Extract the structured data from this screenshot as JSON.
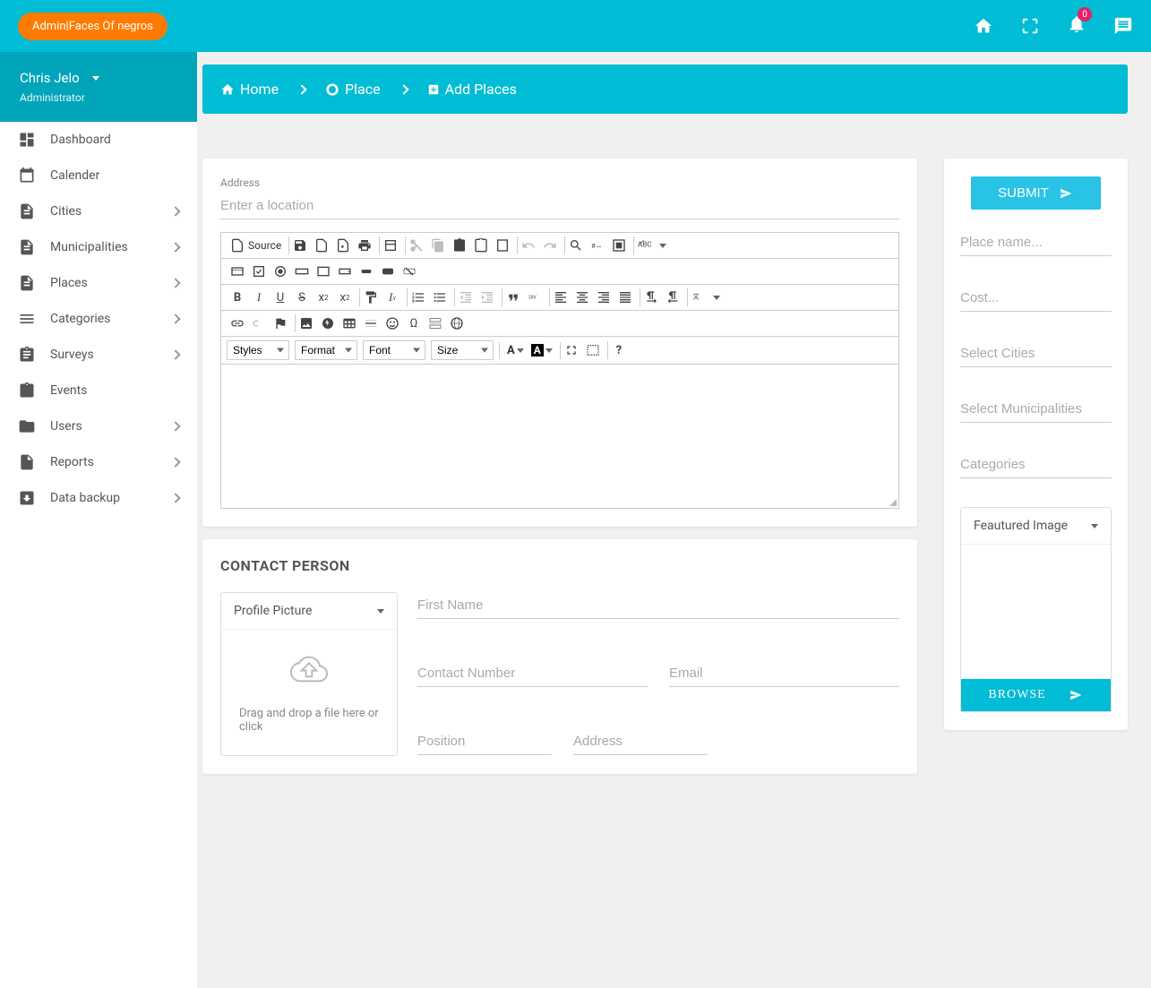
{
  "topbar": {
    "brand": "Admin|Faces Of negros",
    "badge": "0"
  },
  "profile": {
    "name": "Chris Jelo",
    "role": "Administrator"
  },
  "nav": [
    {
      "label": "Dashboard",
      "expandable": false
    },
    {
      "label": "Calender",
      "expandable": false
    },
    {
      "label": "Cities",
      "expandable": true
    },
    {
      "label": "Municipalities",
      "expandable": true
    },
    {
      "label": "Places",
      "expandable": true
    },
    {
      "label": "Categories",
      "expandable": true
    },
    {
      "label": "Surveys",
      "expandable": true
    },
    {
      "label": "Events",
      "expandable": false
    },
    {
      "label": "Users",
      "expandable": true
    },
    {
      "label": "Reports",
      "expandable": true
    },
    {
      "label": "Data backup",
      "expandable": true
    }
  ],
  "breadcrumb": {
    "home": "Home",
    "place": "Place",
    "add": "Add Places"
  },
  "address": {
    "label": "Address",
    "placeholder": "Enter a location"
  },
  "editor": {
    "source": "Source",
    "styles": "Styles",
    "format": "Format",
    "font": "Font",
    "size": "Size"
  },
  "contact": {
    "title": "CONTACT PERSON",
    "profile_header": "Profile Picture",
    "drop_text": "Drag and drop a file here or click",
    "first_name": "First Name",
    "contact_number": "Contact Number",
    "email": "Email",
    "position": "Position",
    "address": "Address"
  },
  "right": {
    "submit": "SUBMIT",
    "place_name": "Place name...",
    "cost": "Cost...",
    "select_cities": "Select Cities",
    "select_muni": "Select Municipalities",
    "categories": "Categories",
    "featured": "Feautured Image",
    "browse": "BROWSE"
  }
}
